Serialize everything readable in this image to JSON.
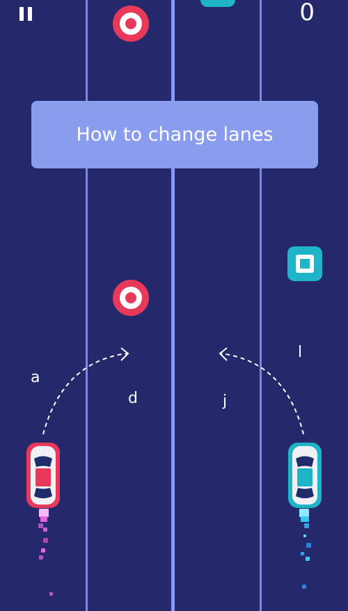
{
  "hud": {
    "score": "0",
    "pause_icon": "pause-icon"
  },
  "tutorial": {
    "banner_text": "How to change lanes"
  },
  "keys": {
    "left_car_left": "a",
    "left_car_right": "d",
    "right_car_left": "j",
    "right_car_right": "l"
  },
  "colors": {
    "background": "#25296b",
    "lane_line": "#7d89e6",
    "banner": "#8a9ced",
    "red_car": "#e8395a",
    "blue_car": "#20b4c8",
    "circle_obstacle": "#e8395a",
    "square_obstacle": "#20b4c8"
  }
}
